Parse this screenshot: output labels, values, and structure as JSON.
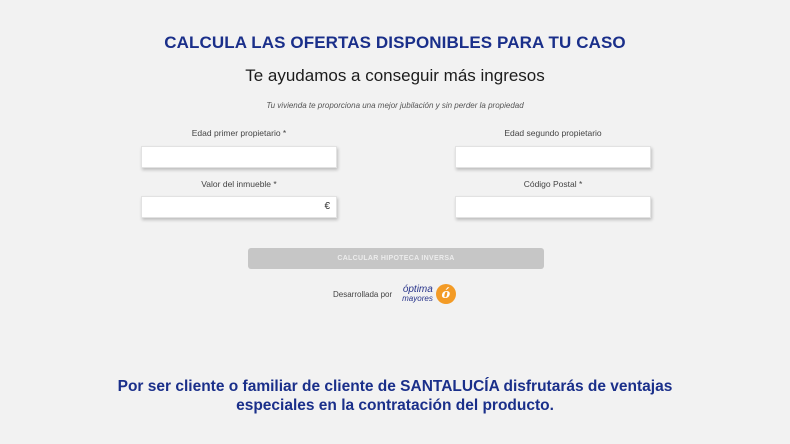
{
  "header": {
    "title": "CALCULA LAS OFERTAS DISPONIBLES PARA TU CASO",
    "subtitle": "Te ayudamos a conseguir más ingresos",
    "tagline": "Tu vivienda te proporciona una mejor jubilación y sin perder la propiedad"
  },
  "form": {
    "edad_primer": {
      "label": "Edad primer propietario *",
      "value": ""
    },
    "edad_segundo": {
      "label": "Edad segundo propietario",
      "value": ""
    },
    "valor_inmueble": {
      "label": "Valor del inmueble *",
      "value": "",
      "suffix": "€"
    },
    "codigo_postal": {
      "label": "Código Postal *",
      "value": ""
    },
    "submit_label": "CALCULAR HIPOTECA INVERSA"
  },
  "developer": {
    "label": "Desarrollada por",
    "logo_top": "óptima",
    "logo_bottom": "mayores",
    "logo_badge": "ó"
  },
  "promo": {
    "text": "Por ser cliente o familiar de cliente de SANTALUCÍA disfrutarás de ventajas especiales en la contratación del producto."
  },
  "colors": {
    "brand_blue": "#1a2f8a",
    "button_disabled": "#c6c6c6",
    "logo_orange": "#f39b26"
  }
}
